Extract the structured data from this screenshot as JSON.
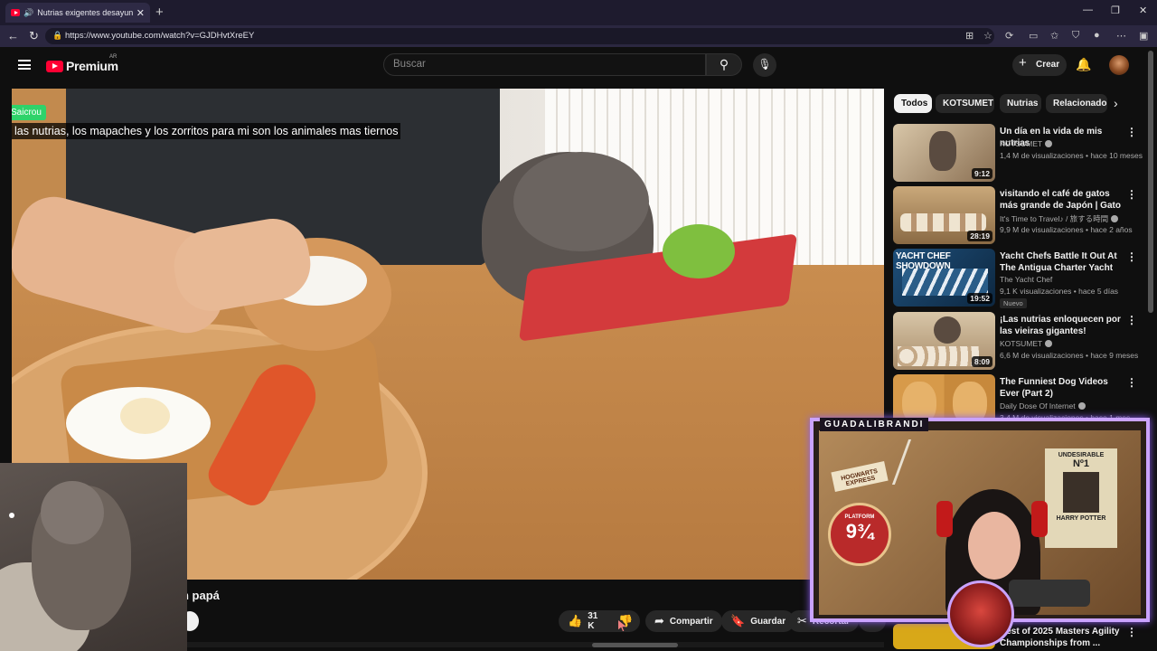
{
  "browser": {
    "tab_title": "Nutrias exigentes desayunan con papá",
    "url": "https://www.youtube.com/watch?v=GJDHvtXreEY"
  },
  "header": {
    "logo_word": "Premium",
    "country": "AR",
    "search_placeholder": "Buscar",
    "create_label": "Crear"
  },
  "video": {
    "chat_user": "Saicrou",
    "chat_message": "las nutrias, los mapaches y los zorritos para mi son los animales mas tiernos",
    "title_visible": "n papá"
  },
  "actions": {
    "likes": "31 K",
    "share": "Compartir",
    "save": "Guardar",
    "clip": "Recortar"
  },
  "chips": [
    "Todos",
    "KOTSUMET",
    "Nutrias",
    "Relacionados"
  ],
  "recommendations": [
    {
      "title": "Un día en la vida de mis nutrias",
      "channel": "KOTSUMET",
      "views": "1,4 M de visualizaciones",
      "age": "hace 10 meses",
      "duration": "9:12",
      "verified": true,
      "badge": ""
    },
    {
      "title": "visitando el café de gatos más grande de Japón | Gato Café ...",
      "channel": "It's Time to Travel♪ / 旅する時間",
      "views": "9,9 M de visualizaciones",
      "age": "hace 2 años",
      "duration": "28:19",
      "verified": true,
      "badge": ""
    },
    {
      "title": "Yacht Chefs Battle It Out At The Antigua Charter Yacht Show | ...",
      "channel": "The Yacht Chef",
      "views": "9,1 K visualizaciones",
      "age": "hace 5 días",
      "duration": "19:52",
      "verified": false,
      "badge": "Nuevo"
    },
    {
      "title": "¡Las nutrias enloquecen por las vieiras gigantes!",
      "channel": "KOTSUMET",
      "views": "6,6 M de visualizaciones",
      "age": "hace 9 meses",
      "duration": "8:09",
      "verified": true,
      "badge": ""
    },
    {
      "title": "The Funniest Dog Videos Ever (Part 2)",
      "channel": "Daily Dose Of Internet",
      "views": "3,4 M de visualizaciones",
      "age": "hace 1 mes",
      "duration": "",
      "verified": true,
      "badge": ""
    },
    {
      "title": "Best of 2025 Masters Agility Championships from ...",
      "channel": "",
      "views": "",
      "age": "",
      "duration": "",
      "verified": false,
      "badge": ""
    }
  ],
  "thumb_text": {
    "yacht": "YACHT CHEF SHOWDOWN"
  },
  "overlay": {
    "streamer_name": "GUADALIBRANDI",
    "poster_top": "UNDESIRABLE",
    "poster_no": "Nº1",
    "poster_name": "HARRY POTTER",
    "sign_text": "HOGWARTS EXPRESS",
    "platform_text": "PLATFORM",
    "platform_num": "9¾"
  },
  "colors": {
    "accent_red": "#ff0033",
    "frame_purple": "#caa3ff",
    "chat_green": "#2fd36a"
  }
}
